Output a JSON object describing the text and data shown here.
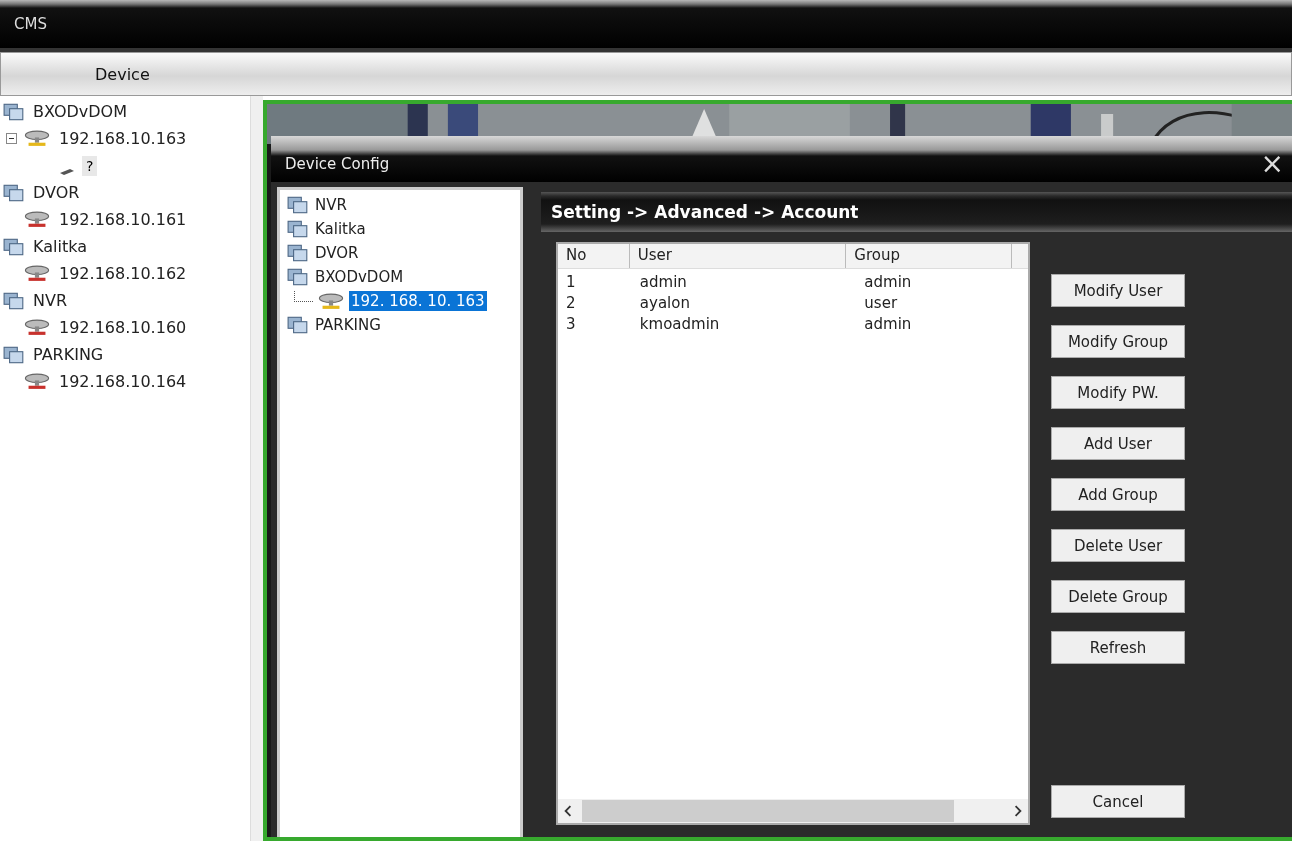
{
  "window": {
    "title": "CMS"
  },
  "tabs": [
    {
      "label": "Device",
      "selected": true
    }
  ],
  "device_tree": [
    {
      "label": "BXODvDOM",
      "kind": "group",
      "children": [
        {
          "label": "192.168.10.163",
          "kind": "device",
          "online": true,
          "expanded": true,
          "children": [
            {
              "label": "?",
              "kind": "channel"
            }
          ]
        }
      ]
    },
    {
      "label": "DVOR",
      "kind": "group",
      "children": [
        {
          "label": "192.168.10.161",
          "kind": "device",
          "online": false
        }
      ]
    },
    {
      "label": "Kalitka",
      "kind": "group",
      "children": [
        {
          "label": "192.168.10.162",
          "kind": "device",
          "online": false
        }
      ]
    },
    {
      "label": "NVR",
      "kind": "group",
      "children": [
        {
          "label": "192.168.10.160",
          "kind": "device",
          "online": false
        }
      ]
    },
    {
      "label": "PARKING",
      "kind": "group",
      "children": [
        {
          "label": "192.168.10.164",
          "kind": "device",
          "online": false
        }
      ]
    }
  ],
  "dialog": {
    "title": "Device Config",
    "close": "×",
    "tree": [
      {
        "label": "NVR",
        "kind": "group"
      },
      {
        "label": "Kalitka",
        "kind": "group"
      },
      {
        "label": "DVOR",
        "kind": "group"
      },
      {
        "label": "BXODvDOM",
        "kind": "group",
        "children": [
          {
            "label": "192. 168. 10. 163",
            "kind": "device",
            "online": true,
            "selected": true
          }
        ]
      },
      {
        "label": "PARKING",
        "kind": "group"
      }
    ],
    "breadcrumb": "Setting -> Advanced -> Account",
    "table": {
      "columns": [
        "No",
        "User",
        "Group"
      ],
      "rows": [
        [
          "1",
          "admin",
          "admin"
        ],
        [
          "2",
          "ayalon",
          "user"
        ],
        [
          "3",
          "kmoadmin",
          "admin"
        ]
      ]
    },
    "buttons": [
      "Modify User",
      "Modify Group",
      "Modify PW.",
      "Add User",
      "Add Group",
      "Delete User",
      "Delete Group",
      "Refresh"
    ],
    "cancel": "Cancel"
  }
}
